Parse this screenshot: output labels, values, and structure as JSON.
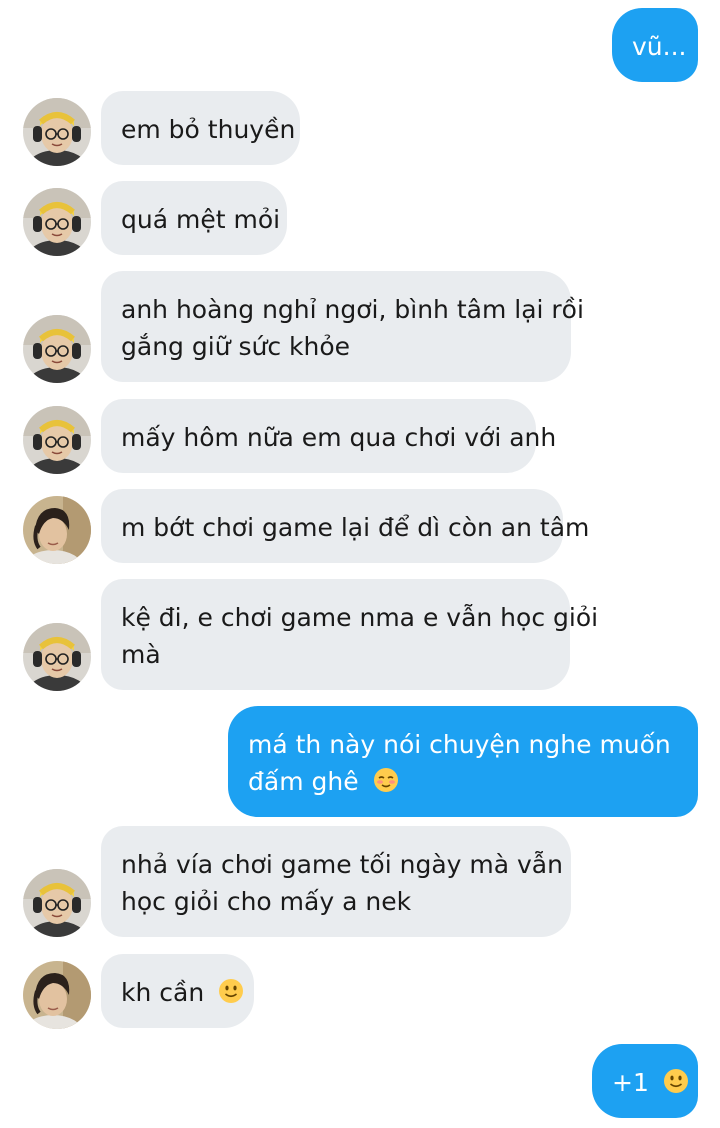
{
  "messages": [
    {
      "side": "out",
      "lines": [
        "vũ..."
      ]
    },
    {
      "side": "in",
      "sender": "a",
      "lines": [
        "em bỏ thuyền"
      ]
    },
    {
      "side": "in",
      "sender": "a",
      "lines": [
        "quá mệt mỏi"
      ]
    },
    {
      "side": "in",
      "sender": "a",
      "lines": [
        "anh hoàng nghỉ ngơi, bình tâm lại rồi",
        "gắng giữ sức khỏe"
      ]
    },
    {
      "side": "in",
      "sender": "a",
      "lines": [
        "mấy hôm nữa em qua chơi với anh"
      ]
    },
    {
      "side": "in",
      "sender": "b",
      "lines": [
        "m bớt chơi game lại để dì còn an tâm"
      ]
    },
    {
      "side": "in",
      "sender": "a",
      "lines": [
        "kệ đi, e chơi game nma e vẫn học giỏi",
        "mà"
      ]
    },
    {
      "side": "out",
      "lines": [
        "má th này nói chuyện nghe muốn",
        "đấm ghê"
      ],
      "emoji": "relieved-face"
    },
    {
      "side": "in",
      "sender": "a",
      "lines": [
        "nhả vía chơi game tối ngày mà vẫn",
        "học giỏi cho mấy a nek"
      ]
    },
    {
      "side": "in",
      "sender": "b",
      "lines": [
        "kh cần"
      ],
      "emoji": "slightly-smiling-face"
    },
    {
      "side": "out",
      "lines": [
        "+1"
      ],
      "emoji": "slightly-smiling-face"
    }
  ],
  "colors": {
    "incoming_bubble": "#e9ecef",
    "outgoing_bubble": "#1da1f2",
    "incoming_text": "#1a1a1a",
    "outgoing_text": "#ffffff"
  }
}
